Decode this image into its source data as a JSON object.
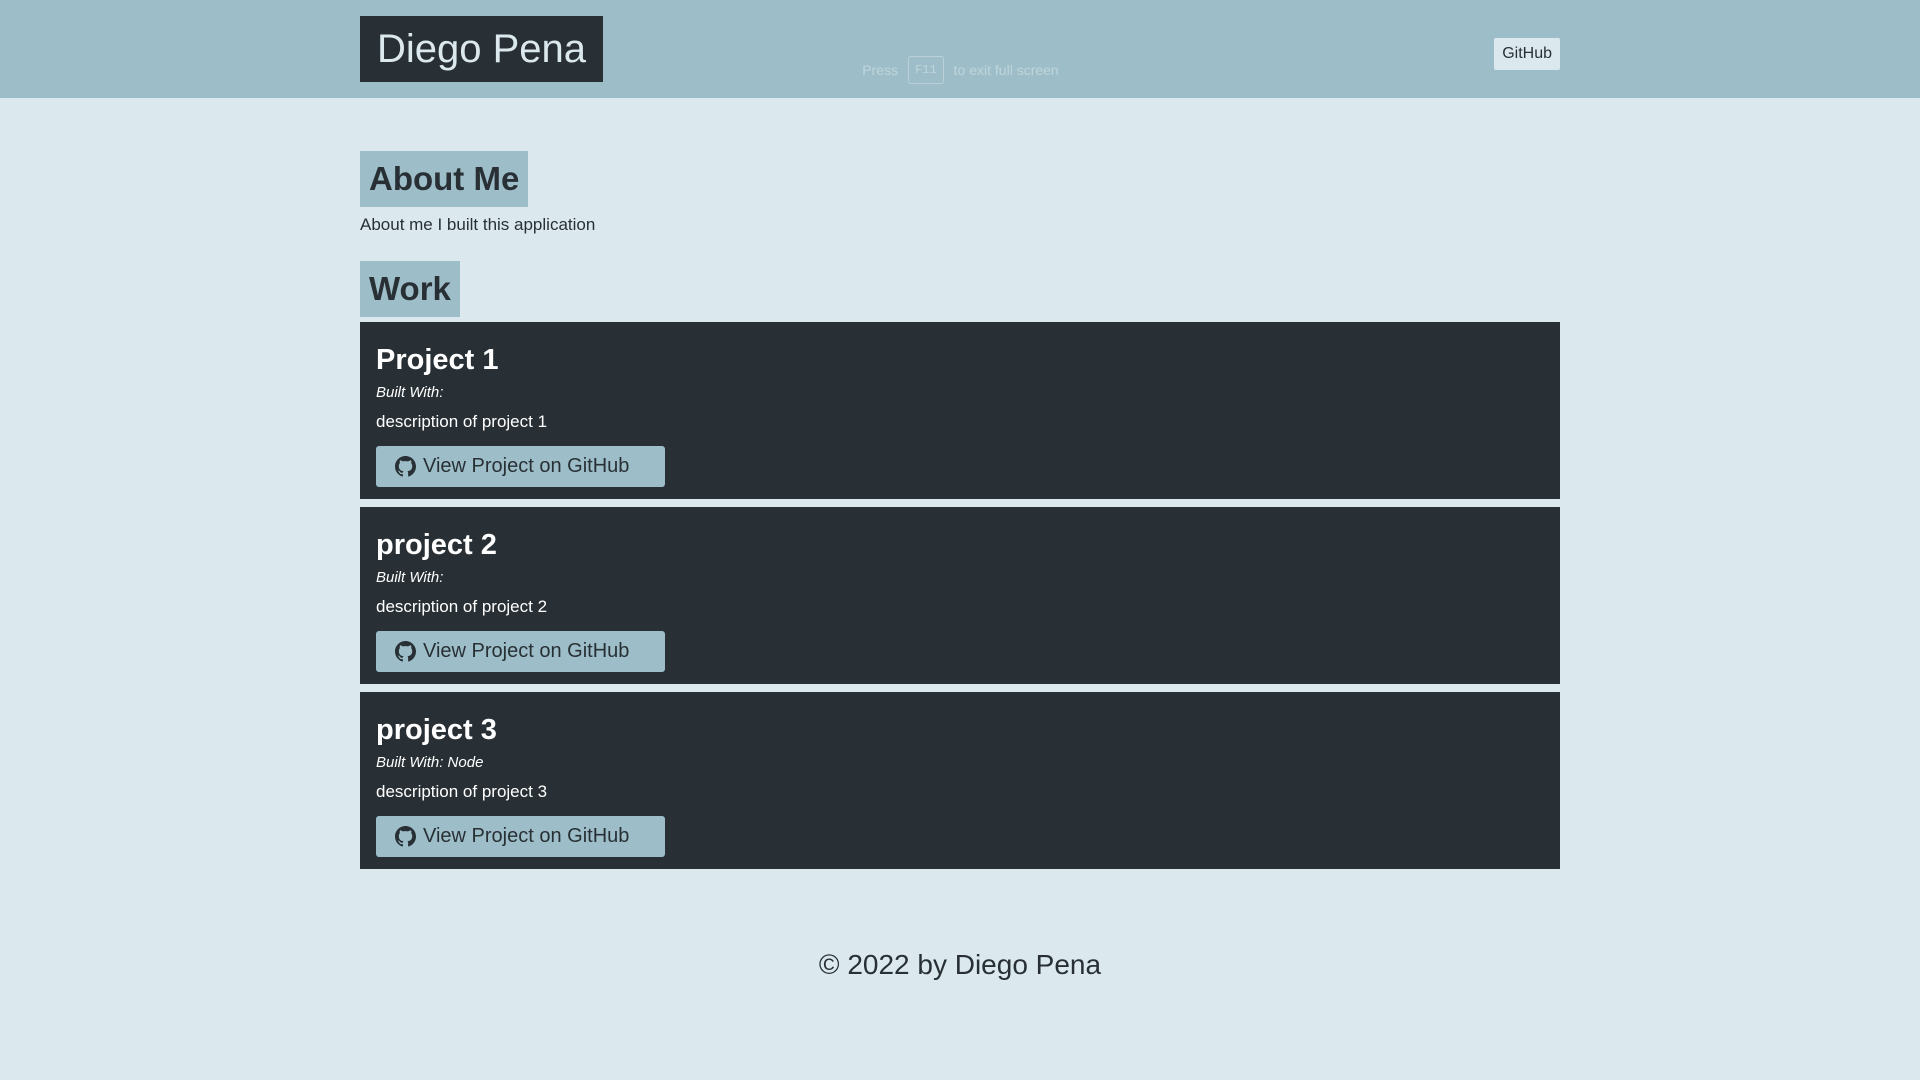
{
  "header": {
    "brand": "Diego Pena",
    "github_link": "GitHub"
  },
  "fullscreen_hint": {
    "before": "Press",
    "key": "F11",
    "after": "to exit full screen"
  },
  "about": {
    "title": "About Me",
    "text": "About me I built this application"
  },
  "work": {
    "title": "Work",
    "projects": [
      {
        "title": "Project 1",
        "built_with": "Built With:",
        "description": "description of project 1",
        "button_label": "View Project on GitHub"
      },
      {
        "title": "project 2",
        "built_with": "Built With:",
        "description": "description of project 2",
        "button_label": "View Project on GitHub"
      },
      {
        "title": "project 3",
        "built_with": "Built With: Node",
        "description": "description of project 3",
        "button_label": "View Project on GitHub"
      }
    ]
  },
  "footer": {
    "text": "© 2022 by Diego Pena"
  },
  "icons": {
    "button_icon": "github-icon"
  },
  "colors": {
    "background": "#dbe9ee",
    "header": "#9dbec8",
    "dark": "#283035"
  }
}
